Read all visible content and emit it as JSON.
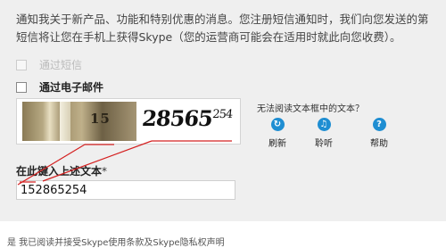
{
  "intro": {
    "line1": "通知我关于新产品、功能和特别优惠的消息。您注册短信通知时，我们向您发送的第",
    "line2": "短信将让您在手机上获得Skype（您的运营商可能会在适用时就此向您收费）。"
  },
  "options": {
    "sms_label": "通过短信",
    "email_label": "通过电子邮件"
  },
  "captcha": {
    "photo_number": "15",
    "challenge_main": "28565",
    "challenge_sup": "254",
    "hint": "无法阅读文本框中的文本？",
    "refresh_label": "刷新",
    "listen_label": "聆听",
    "help_label": "帮助"
  },
  "icons": {
    "refresh": "↻",
    "listen": "♫",
    "help": "?"
  },
  "form": {
    "field_label": "在此键入上述文本",
    "required_mark": "*",
    "value": "152865254"
  },
  "footer": {
    "text": "是    我已阅读并接受Skype使用条款及Skype隐私权声明"
  },
  "colors": {
    "accent": "#1f8ed2",
    "annotation_red": "#d42020"
  }
}
